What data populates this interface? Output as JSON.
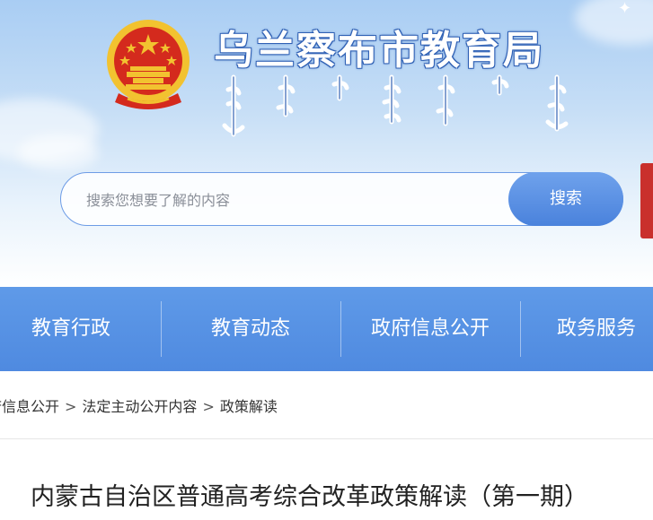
{
  "header": {
    "site_title": "乌兰察布市教育局",
    "search": {
      "placeholder": "搜索您想要了解的内容",
      "button_label": "搜索"
    }
  },
  "nav": {
    "items": [
      {
        "label": "教育行政"
      },
      {
        "label": "教育动态"
      },
      {
        "label": "政府信息公开"
      },
      {
        "label": "政务服务"
      }
    ]
  },
  "breadcrumb": {
    "items": [
      "府信息公开",
      "法定主动公开内容",
      "政策解读"
    ],
    "separator": ">"
  },
  "article": {
    "title": "内蒙古自治区普通高考综合改革政策解读（第一期）"
  },
  "colors": {
    "nav_bg": "#5a94e6",
    "search_button": "#4a82dc",
    "title_outline": "#2d5eb3",
    "emblem_red": "#d42a1d",
    "emblem_gold": "#f2c230"
  }
}
